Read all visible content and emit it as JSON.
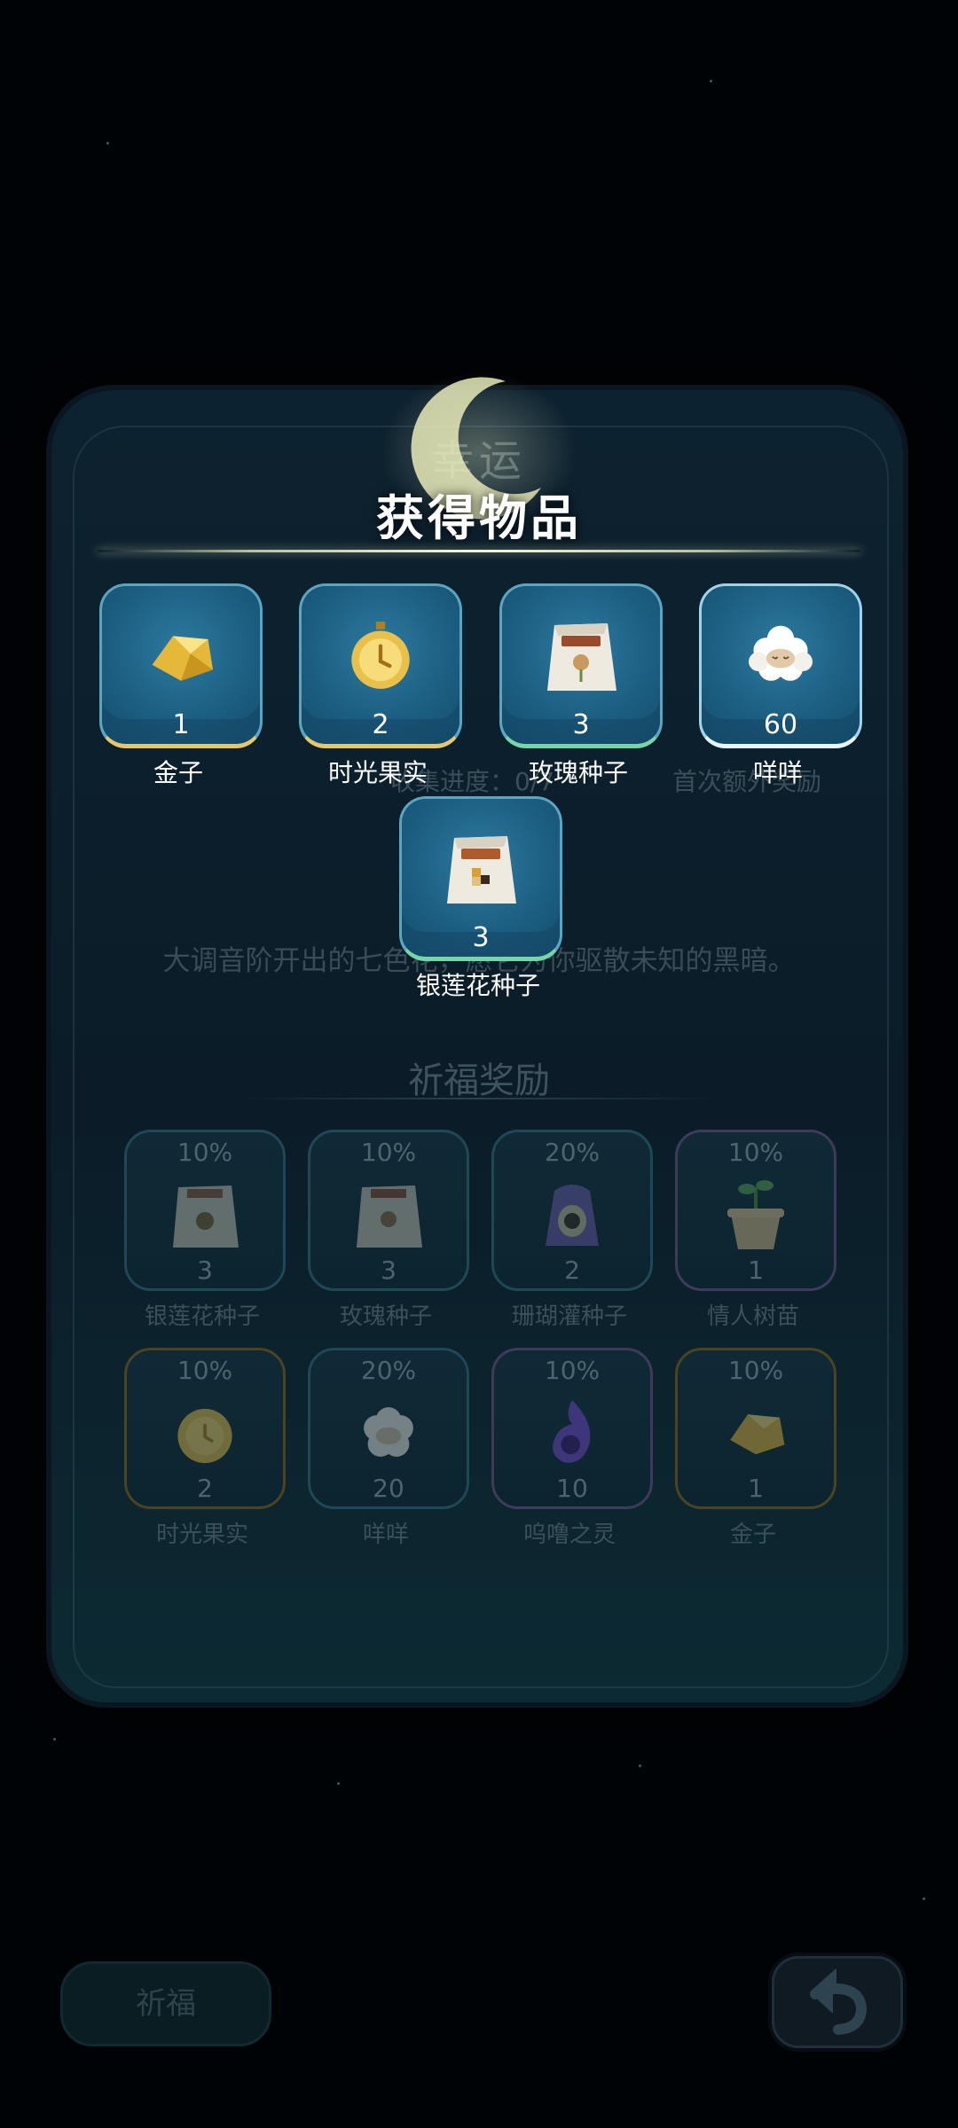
{
  "background_panel": {
    "title": "幸运",
    "progress_label": "收集进度：0/7",
    "bonus_label": "首次额外奖励",
    "description": "大调音阶开出的七色花，愿它为你驱散未知的黑暗。",
    "section_title": "祈福奖励",
    "rewards": [
      {
        "pct": "10%",
        "count": "3",
        "name": "银莲花种子"
      },
      {
        "pct": "10%",
        "count": "3",
        "name": "玫瑰种子"
      },
      {
        "pct": "20%",
        "count": "2",
        "name": "珊瑚灌种子"
      },
      {
        "pct": "10%",
        "count": "1",
        "name": "情人树苗"
      },
      {
        "pct": "10%",
        "count": "2",
        "name": "时光果实"
      },
      {
        "pct": "20%",
        "count": "20",
        "name": "咩咩"
      },
      {
        "pct": "10%",
        "count": "10",
        "name": "呜噜之灵"
      },
      {
        "pct": "10%",
        "count": "1",
        "name": "金子"
      }
    ],
    "pray_button_label": "祈福"
  },
  "dialog": {
    "title": "获得物品",
    "items": [
      {
        "count": "1",
        "name": "金子",
        "icon": "gold-nugget-icon"
      },
      {
        "count": "2",
        "name": "时光果实",
        "icon": "time-fruit-icon"
      },
      {
        "count": "3",
        "name": "玫瑰种子",
        "icon": "rose-seed-bag-icon"
      },
      {
        "count": "60",
        "name": "咩咩",
        "icon": "sheep-icon"
      },
      {
        "count": "3",
        "name": "银莲花种子",
        "icon": "anemone-seed-bag-icon"
      }
    ]
  },
  "colors": {
    "tile_blue": "#1b5d80",
    "gold_accent": "#e8c76a",
    "text_white": "#ffffff"
  }
}
